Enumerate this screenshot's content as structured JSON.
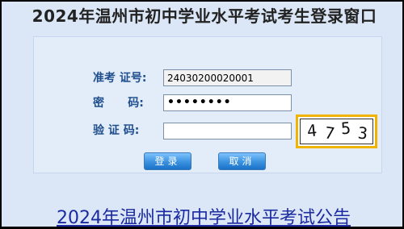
{
  "header": {
    "title": "2024年温州市初中学业水平考试考生登录窗口"
  },
  "login_form": {
    "exam_number_label": "准考 证号:",
    "exam_number_value": "24030200020001",
    "password_label": "密      码:",
    "password_value": "••••••••",
    "captcha_label": "验 证 码:",
    "captcha_value": "",
    "captcha_digits": [
      "4",
      "7",
      "5",
      "3"
    ],
    "login_button": "登录",
    "cancel_button": "取消"
  },
  "footer": {
    "notice_link": "2024年温州市初中学业水平考试公告"
  },
  "colors": {
    "background": "#dbe7f7",
    "label_blue": "#1f4e8c",
    "captcha_border": "#f0b400",
    "link": "#1b2aa0"
  }
}
